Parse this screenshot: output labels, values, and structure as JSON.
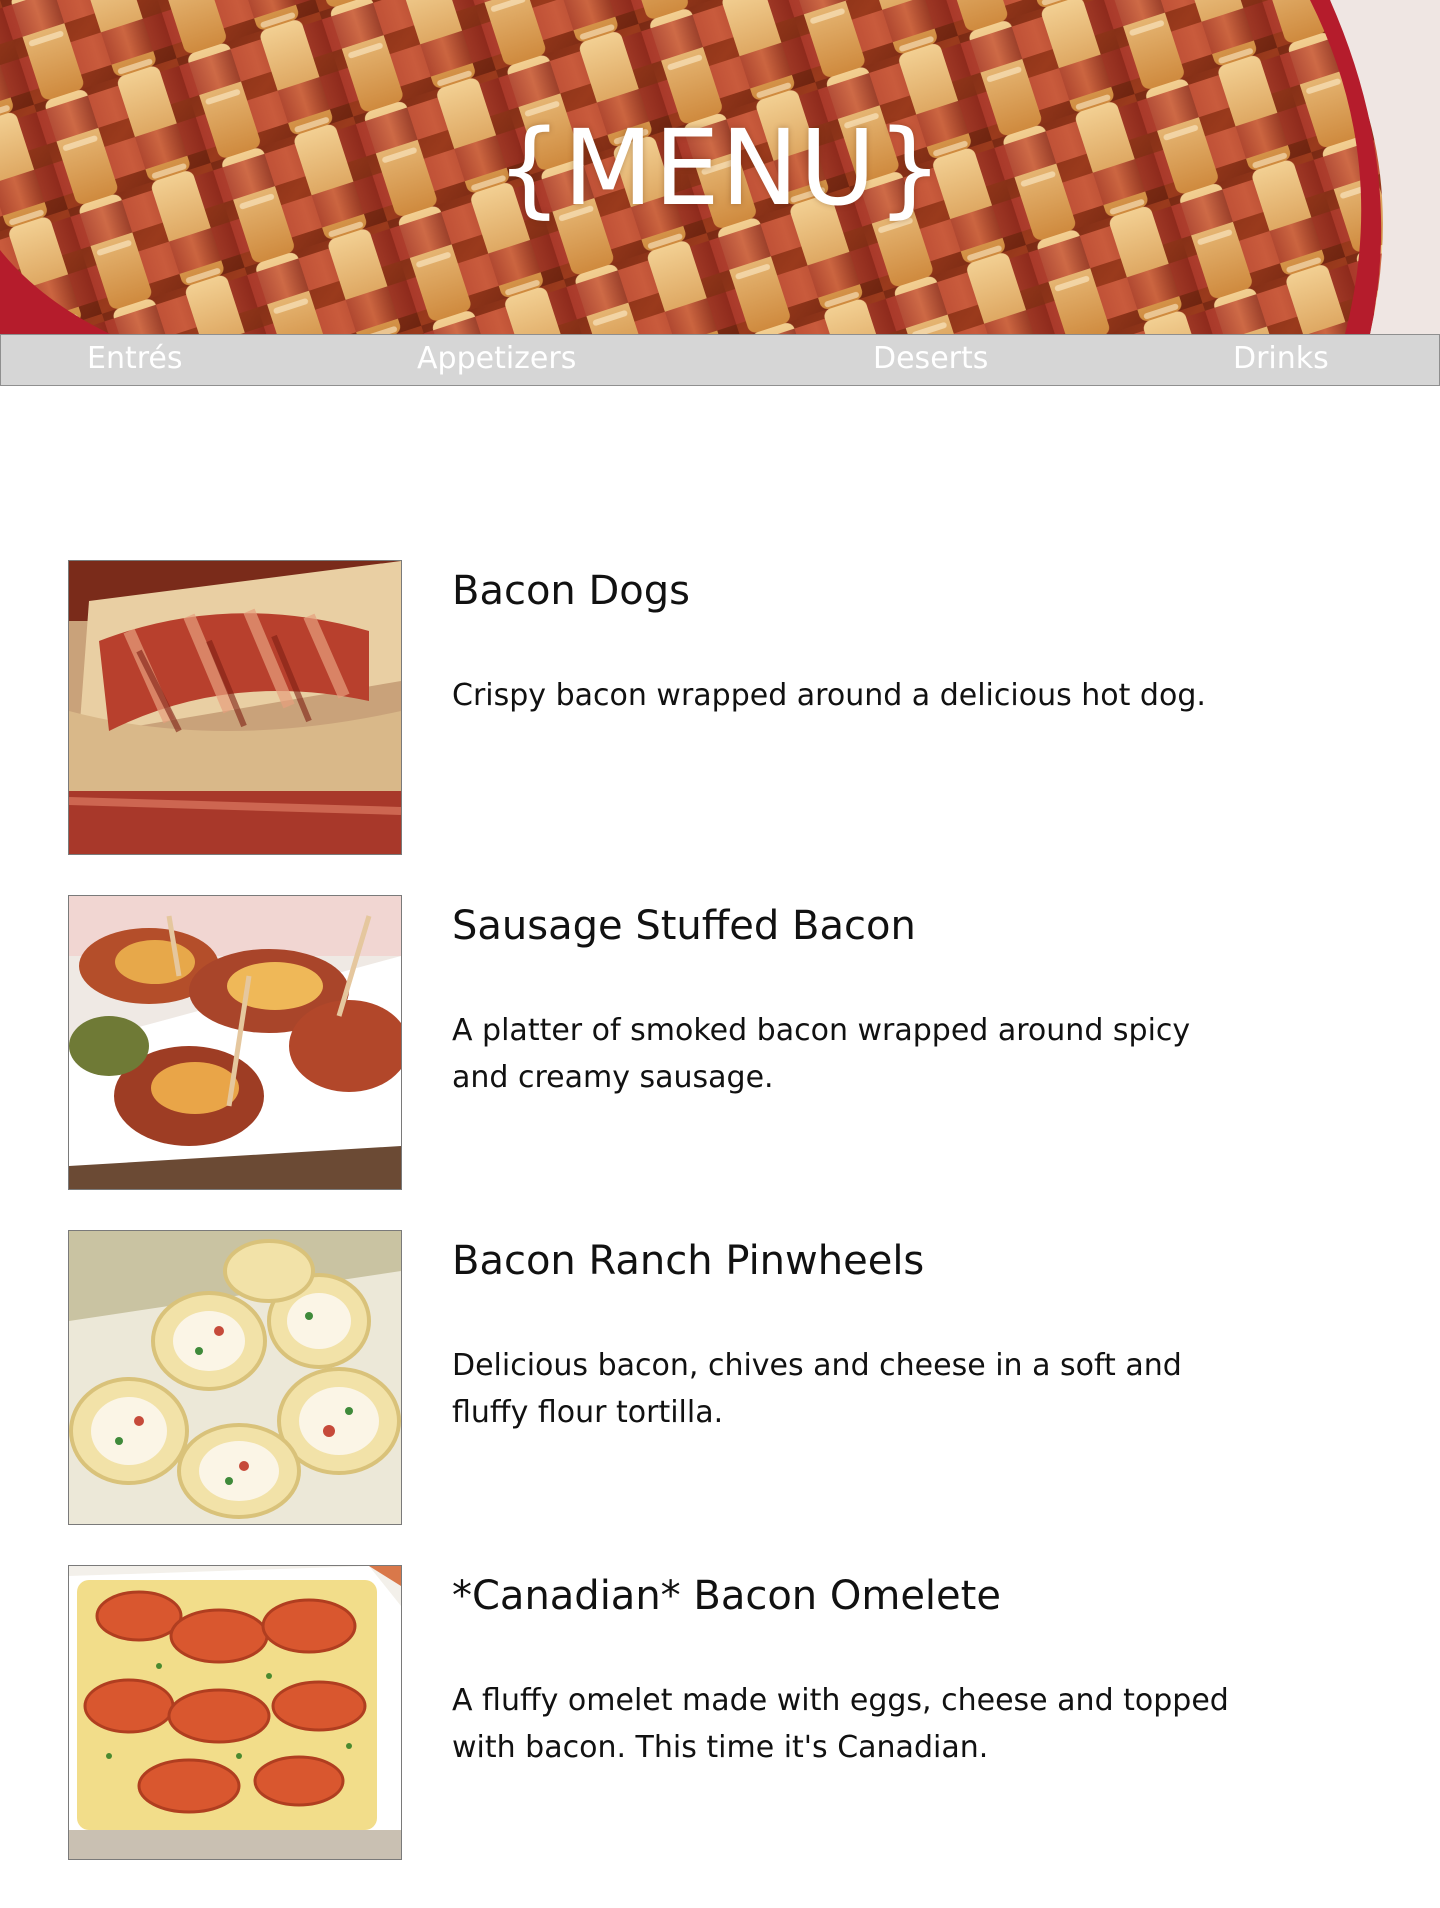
{
  "header": {
    "title": "{MENU}",
    "banner_image": "bacon-lattice-pie-photo"
  },
  "nav": {
    "items": [
      {
        "label": "Entrés"
      },
      {
        "label": "Appetizers"
      },
      {
        "label": "Deserts"
      },
      {
        "label": "Drinks"
      }
    ]
  },
  "menu": {
    "items": [
      {
        "title": "Bacon Dogs",
        "description": "Crispy bacon wrapped around a delicious hot dog.",
        "image": "bacon-dogs-photo"
      },
      {
        "title": "Sausage Stuffed Bacon",
        "description": "A platter of smoked bacon wrapped around spicy and creamy sausage.",
        "image": "sausage-stuffed-bacon-photo"
      },
      {
        "title": "Bacon Ranch Pinwheels",
        "description": "Delicious bacon, chives and cheese in a soft and fluffy flour tortilla.",
        "image": "bacon-ranch-pinwheels-photo"
      },
      {
        "title": "*Canadian* Bacon Omelete",
        "description": "A fluffy omelet made with eggs, cheese and topped with bacon.  This time it's Canadian.",
        "image": "canadian-bacon-omelete-photo"
      }
    ]
  },
  "colors": {
    "nav_background": "#d6d6d6",
    "nav_text": "#ffffff",
    "title_text": "#ffffff",
    "body_text": "#111111"
  }
}
